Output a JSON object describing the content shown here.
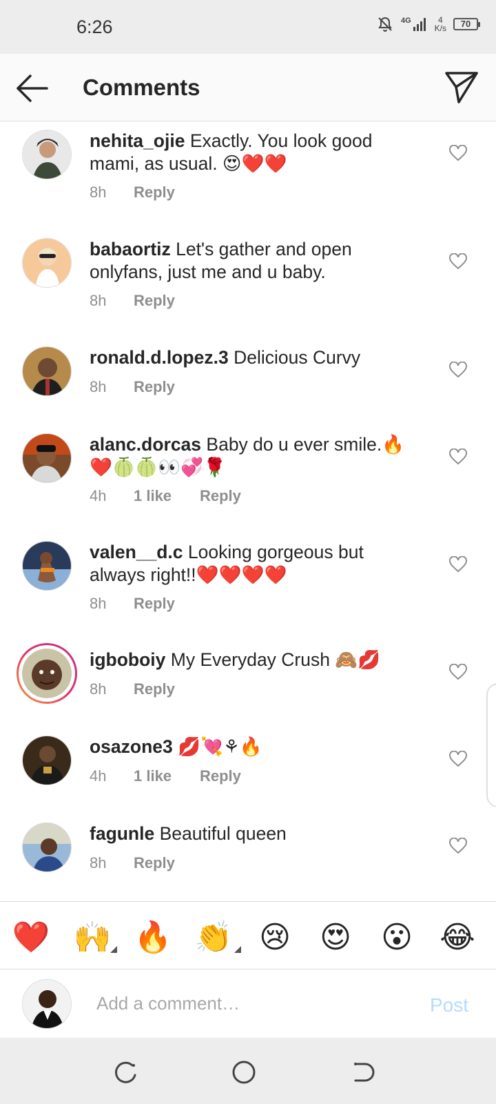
{
  "status_bar": {
    "time": "6:26",
    "network": "4G",
    "speed_value": "4",
    "speed_unit": "K/s",
    "battery": "70"
  },
  "header": {
    "title": "Comments",
    "back_icon": "arrow-left-icon",
    "share_icon": "paper-plane-icon"
  },
  "comments": [
    {
      "username": "nehita_ojie",
      "text": "Exactly. You look good mami, as usual. 😍❤️❤️",
      "time": "8h",
      "likes": "",
      "reply": "Reply"
    },
    {
      "username": "babaortiz",
      "text": "Let's gather and open onlyfans, just me and u baby.",
      "time": "8h",
      "likes": "",
      "reply": "Reply"
    },
    {
      "username": "ronald.d.lopez.3",
      "text": "Delicious Curvy",
      "time": "8h",
      "likes": "",
      "reply": "Reply"
    },
    {
      "username": "alanc.dorcas",
      "text": "Baby do u ever smile.🔥❤️🍈🍈👀💞🌹",
      "time": "4h",
      "likes": "1 like",
      "reply": "Reply"
    },
    {
      "username": "valen__d.c",
      "text": "Looking gorgeous but always right!!❤️❤️❤️❤️",
      "time": "8h",
      "likes": "",
      "reply": "Reply"
    },
    {
      "username": "igboboiy",
      "text": "My Everyday Crush 🙈💋",
      "time": "8h",
      "likes": "",
      "reply": "Reply"
    },
    {
      "username": "osazone3",
      "text": "💋💘⚘🔥",
      "time": "4h",
      "likes": "1 like",
      "reply": "Reply"
    },
    {
      "username": "fagunle",
      "text": "Beautiful queen",
      "time": "8h",
      "likes": "",
      "reply": "Reply"
    }
  ],
  "emoji_bar": [
    "❤️",
    "🙌",
    "🔥",
    "👏",
    "😢",
    "😍",
    "😮",
    "😂"
  ],
  "add_comment": {
    "placeholder": "Add a comment…",
    "post_label": "Post"
  },
  "colors": {
    "status_bg": "#ededed",
    "header_bg": "#fafafa",
    "text": "#262626",
    "meta": "#8e8e8e",
    "post_disabled": "#b3dbff"
  }
}
